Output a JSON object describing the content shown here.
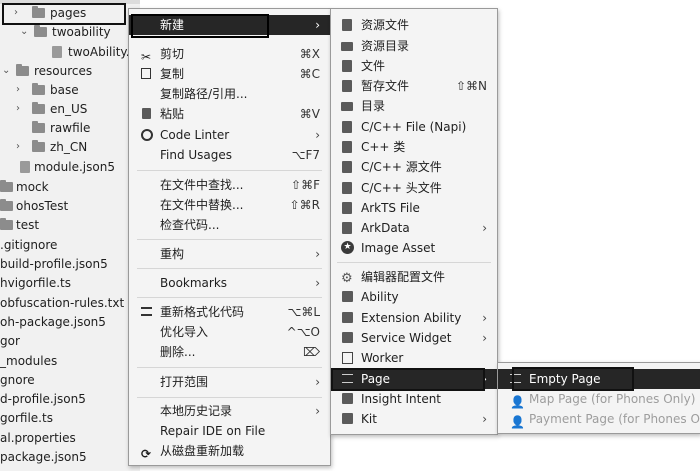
{
  "tree": {
    "items": [
      {
        "label": "pages"
      },
      {
        "label": "twoability"
      },
      {
        "label": "twoAbility."
      },
      {
        "label": "resources"
      },
      {
        "label": "base"
      },
      {
        "label": "en_US"
      },
      {
        "label": "rawfile"
      },
      {
        "label": "zh_CN"
      },
      {
        "label": "module.json5"
      },
      {
        "label": "mock"
      },
      {
        "label": "ohosTest"
      },
      {
        "label": "test"
      },
      {
        "label": ".gitignore"
      },
      {
        "label": "build-profile.json5"
      },
      {
        "label": "hvigorfile.ts"
      },
      {
        "label": "obfuscation-rules.txt"
      },
      {
        "label": "oh-package.json5"
      },
      {
        "label": "gor"
      },
      {
        "label": "_modules"
      },
      {
        "label": "gnore"
      },
      {
        "label": "d-profile.json5"
      },
      {
        "label": "gorfile.ts"
      },
      {
        "label": "al.properties"
      },
      {
        "label": "package.json5"
      }
    ]
  },
  "context_menu": {
    "items": [
      {
        "label": "新建",
        "shortcut": "",
        "arrow": "›"
      },
      {
        "label": "剪切",
        "shortcut": "⌘X"
      },
      {
        "label": "复制",
        "shortcut": "⌘C"
      },
      {
        "label": "复制路径/引用...",
        "shortcut": ""
      },
      {
        "label": "粘贴",
        "shortcut": "⌘V"
      },
      {
        "label": "Code Linter",
        "shortcut": "",
        "arrow": "›"
      },
      {
        "label": "Find Usages",
        "shortcut": "⌥F7"
      },
      {
        "label": "在文件中查找...",
        "shortcut": "⇧⌘F"
      },
      {
        "label": "在文件中替换...",
        "shortcut": "⇧⌘R"
      },
      {
        "label": "检查代码...",
        "shortcut": ""
      },
      {
        "label": "重构",
        "shortcut": "",
        "arrow": "›"
      },
      {
        "label": "Bookmarks",
        "shortcut": "",
        "arrow": "›"
      },
      {
        "label": "重新格式化代码",
        "shortcut": "⌥⌘L"
      },
      {
        "label": "优化导入",
        "shortcut": "^⌥O"
      },
      {
        "label": "删除...",
        "shortcut": "⌦"
      },
      {
        "label": "打开范围",
        "shortcut": "",
        "arrow": "›"
      },
      {
        "label": "本地历史记录",
        "shortcut": "",
        "arrow": "›"
      },
      {
        "label": "Repair IDE on File",
        "shortcut": ""
      },
      {
        "label": "从磁盘重新加载",
        "shortcut": ""
      }
    ]
  },
  "new_menu": {
    "items": [
      {
        "label": "资源文件"
      },
      {
        "label": "资源目录"
      },
      {
        "label": "文件"
      },
      {
        "label": "暂存文件",
        "shortcut": "⇧⌘N"
      },
      {
        "label": "目录"
      },
      {
        "label": "C/C++ File (Napi)"
      },
      {
        "label": "C++ 类"
      },
      {
        "label": "C/C++ 源文件"
      },
      {
        "label": "C/C++ 头文件"
      },
      {
        "label": "ArkTS File"
      },
      {
        "label": "ArkData",
        "arrow": "›"
      },
      {
        "label": "Image Asset"
      },
      {
        "label": "编辑器配置文件"
      },
      {
        "label": "Ability"
      },
      {
        "label": "Extension Ability",
        "arrow": "›"
      },
      {
        "label": "Service Widget",
        "arrow": "›"
      },
      {
        "label": "Worker"
      },
      {
        "label": "Page",
        "arrow": "›"
      },
      {
        "label": "Insight Intent"
      },
      {
        "label": "Kit",
        "arrow": "›"
      }
    ]
  },
  "page_menu": {
    "items": [
      {
        "label": "Empty Page"
      },
      {
        "label": "Map Page (for Phones Only)"
      },
      {
        "label": "Payment Page (for Phones O"
      }
    ]
  },
  "icons": {
    "folder": "folder-icon",
    "cut": "scissors-icon",
    "copy": "copy-icon",
    "paste": "clipboard-icon",
    "linter": "code-linter-icon",
    "format": "format-icon",
    "delete": "delete-icon",
    "reload": "reload-icon",
    "file": "file-icon",
    "cpp": "cpp-file-icon",
    "ark": "arkts-icon",
    "image": "image-icon",
    "gear": "gear-icon",
    "ability": "ability-icon",
    "worker": "worker-icon",
    "page": "page-icon",
    "kit": "kit-icon"
  },
  "colors": {
    "selection": "#262626",
    "menu_bg": "#f4f4f4",
    "tree_bg": "#f1f1f1"
  }
}
